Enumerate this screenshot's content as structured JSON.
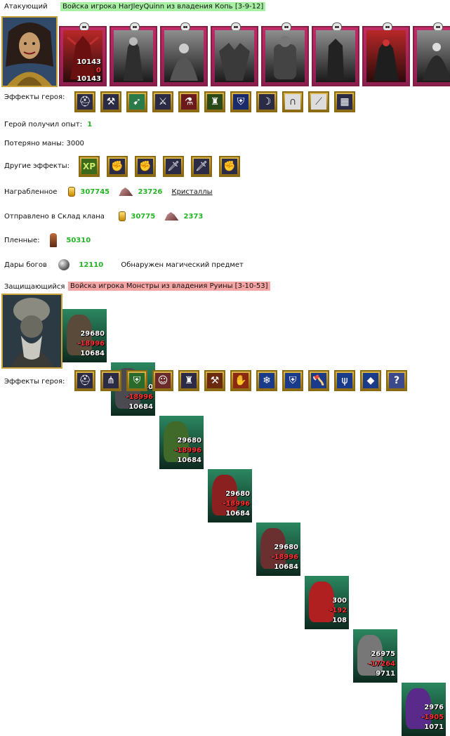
{
  "attacker": {
    "label": "Атакующий",
    "title": "Войска игрока HarJleyQuinn из владения Копь [3-9-12]",
    "units": [
      {
        "name": "demon-unit",
        "count_a": "10143",
        "count_b": "10143",
        "loss": "0"
      },
      {
        "name": "skeleton-knight-unit"
      },
      {
        "name": "wraith-unit"
      },
      {
        "name": "gargoyle-unit"
      },
      {
        "name": "golem-unit"
      },
      {
        "name": "dark-knight-unit"
      },
      {
        "name": "lich-unit"
      },
      {
        "name": "reaper-unit"
      }
    ],
    "effects_label": "Эффекты героя:"
  },
  "battle": {
    "exp_label": "Герой получил опыт:",
    "exp_value": "1",
    "mana_label": "Потеряно маны: 3000",
    "other_effects_label": "Другие эффекты:",
    "loot_label": "Награбленное",
    "loot_gold": "307745",
    "loot_crystals": "23726",
    "loot_crystals_label": "Кристаллы",
    "clan_label": "Отправлено в Склад клана",
    "clan_gold": "30775",
    "clan_crystals": "2373",
    "prisoners_label": "Пленные:",
    "prisoners_value": "50310",
    "gifts_label": "Дары богов",
    "gifts_value": "12110",
    "found_item_label": "Обнаружен  магический предмет"
  },
  "defender": {
    "label": "Защищающийся",
    "title": "Войска игрока Монстры из владения Руины [3-10-53]",
    "units": [
      {
        "a": "29680",
        "b": "-18996",
        "c": "10684",
        "color": "#5a4a3a"
      },
      {
        "a": "29680",
        "b": "-18996",
        "c": "10684",
        "color": "#4a4a50"
      },
      {
        "a": "29680",
        "b": "-18996",
        "c": "10684",
        "color": "#3f6a2a"
      },
      {
        "a": "29680",
        "b": "-18996",
        "c": "10684",
        "color": "#8a2020"
      },
      {
        "a": "29680",
        "b": "-18996",
        "c": "10684",
        "color": "#6a3030"
      },
      {
        "a": "300",
        "b": "-192",
        "c": "108",
        "color": "#b02020"
      },
      {
        "a": "26975",
        "b": "-17264",
        "c": "9711",
        "color": "#777777"
      },
      {
        "a": "2976",
        "b": "-1905",
        "c": "1071",
        "color": "#5a2a8a"
      }
    ],
    "effects_label": "Эффекты героя:"
  },
  "icons": {
    "attacker_effects": [
      "helmet-icon",
      "bone-axe-icon",
      "arrow-icon",
      "sword-heart-icon",
      "potion-icon",
      "idol-icon",
      "shield-icon",
      "amulet-icon",
      "horseshoe-icon",
      "sabre-icon",
      "cage-icon"
    ],
    "other_effects": [
      "xp-icon",
      "fist-sword-icon",
      "fist-sword-icon",
      "sword-icon",
      "sword-icon",
      "fist-sword-icon"
    ],
    "defender_effects": [
      "helmet-icon",
      "spikes-icon",
      "green-shield-icon",
      "warrior-icon",
      "idol-icon",
      "hammers-icon",
      "fire-claw-icon",
      "ice-icon",
      "frost-shield-icon",
      "axe-icon",
      "trident-icon",
      "crystal-icon",
      "unknown-icon"
    ],
    "xp_text": "XP",
    "unknown_text": "?"
  },
  "colors": {
    "attacker_highlight": "#a8f0a4",
    "defender_highlight": "#f6a5a5",
    "value_green": "#23b323",
    "damage_red": "#ff3131"
  }
}
